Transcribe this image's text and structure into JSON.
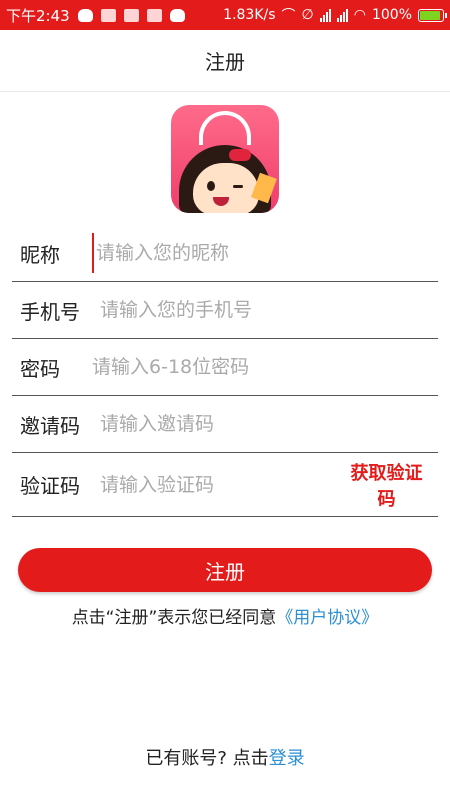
{
  "status_bar": {
    "time": "下午2:43",
    "net_speed": "1.83K/s",
    "battery": "100%",
    "battery_level": 1.0,
    "icons": [
      "cloud-icon",
      "notification-icon",
      "notification-icon",
      "notification-icon",
      "cloud-icon",
      "headphone-icon",
      "mute-icon",
      "signal-icon",
      "signal-icon",
      "wifi-icon",
      "battery-charging-icon"
    ]
  },
  "header": {
    "title": "注册"
  },
  "logo": {
    "icon": "shopping-bag-girl-logo"
  },
  "form": {
    "nickname": {
      "label": "昵称",
      "placeholder": "请输入您的昵称"
    },
    "phone": {
      "label": "手机号",
      "placeholder": "请输入您的手机号"
    },
    "password": {
      "label": "密码",
      "placeholder": "请输入6-18位密码"
    },
    "invite": {
      "label": "邀请码",
      "placeholder": "请输入邀请码"
    },
    "code": {
      "label": "验证码",
      "placeholder": "请输入验证码",
      "get_code": "获取验证码"
    }
  },
  "register_button": "注册",
  "agreement": {
    "prefix": "点击“注册”表示您已经同意",
    "link": "《用户协议》"
  },
  "login": {
    "prefix": "已有账号? 点击",
    "link": "登录"
  },
  "colors": {
    "accent": "#e31b1b",
    "link": "#2b8fd6"
  }
}
